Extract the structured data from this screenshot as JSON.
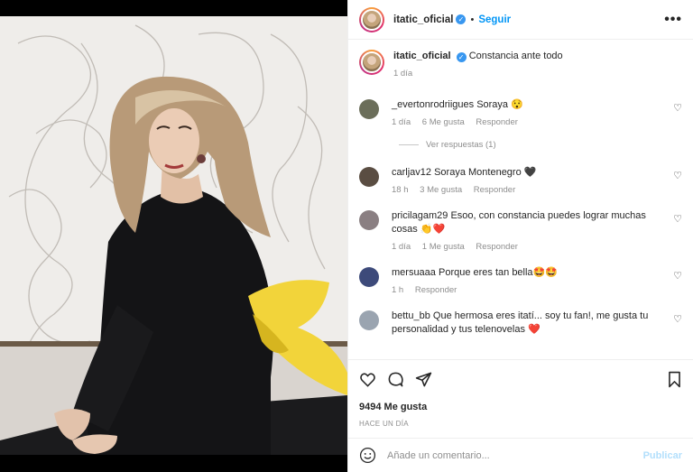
{
  "header": {
    "username": "itatic_oficial",
    "follow_label": "Seguir",
    "dot": "•",
    "more": "•••"
  },
  "caption": {
    "username": "itatic_oficial",
    "text": "Constancia ante todo",
    "time": "1 día"
  },
  "comments": [
    {
      "user": "_evertonrodriigues",
      "text": "Soraya 😯",
      "time": "1 día",
      "likes": "6 Me gusta",
      "reply": "Responder",
      "avatar_color": "#6b6e5a"
    },
    {
      "user": "carljav12",
      "text": "Soraya Montenegro 🖤",
      "time": "18 h",
      "likes": "3 Me gusta",
      "reply": "Responder",
      "avatar_color": "#5a4d42"
    },
    {
      "user": "pricilagam29",
      "text": "Esoo, con constancia puedes lograr muchas cosas 👏❤️",
      "time": "1 día",
      "likes": "1 Me gusta",
      "reply": "Responder",
      "avatar_color": "#8a7f82"
    },
    {
      "user": "mersuaaa",
      "text": "Porque eres tan bella🤩🤩",
      "time": "1 h",
      "likes": "",
      "reply": "Responder",
      "avatar_color": "#3d4a7a"
    },
    {
      "user": "bettu_bb",
      "text": "Que hermosa eres itatí... soy tu fan!, me gusta tu personalidad y tus telenovelas ❤️",
      "time": "",
      "likes": "",
      "reply": "",
      "avatar_color": "#9aa4b0"
    }
  ],
  "view_replies": "Ver respuestas (1)",
  "actions": {
    "likes_count": "9494 Me gusta",
    "time_ago": "HACE UN DÍA"
  },
  "add_comment": {
    "placeholder": "Añade un comentario...",
    "publish_label": "Publicar"
  },
  "colors": {
    "accent": "#0095f6",
    "muted": "#8e8e8e",
    "ribbon": "#f2d43a"
  }
}
